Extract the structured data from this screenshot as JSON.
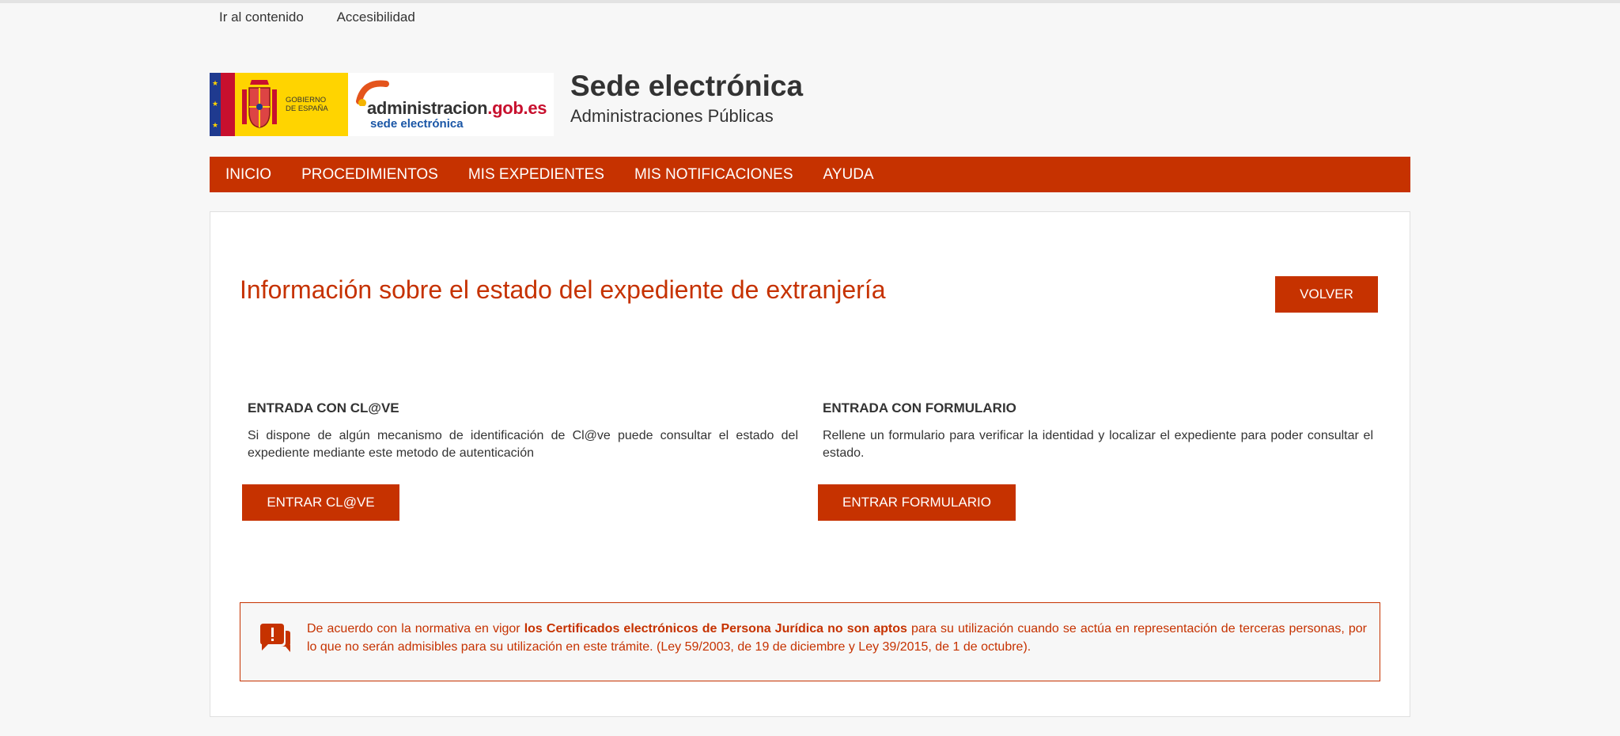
{
  "skip_links": {
    "content": "Ir al contenido",
    "accessibility": "Accesibilidad"
  },
  "logos": {
    "gobierno_line1": "GOBIERNO",
    "gobierno_line2": "DE ESPAÑA",
    "admin_main": "administracion",
    "admin_domain": ".gob.es",
    "admin_sub": "sede electrónica"
  },
  "header": {
    "title": "Sede electrónica",
    "subtitle": "Administraciones Públicas"
  },
  "nav": {
    "items": [
      "INICIO",
      "PROCEDIMIENTOS",
      "MIS EXPEDIENTES",
      "MIS NOTIFICACIONES",
      "AYUDA"
    ]
  },
  "main": {
    "title": "Información sobre el estado del expediente de extranjería",
    "back_button": "VOLVER",
    "clave": {
      "heading": "ENTRADA CON CL@VE",
      "text": "Si dispone de algún mecanismo de identificación de Cl@ve puede consultar el estado del expediente mediante este metodo de autenticación",
      "button": "ENTRAR CL@VE"
    },
    "form": {
      "heading": "ENTRADA CON FORMULARIO",
      "text": "Rellene un formulario para verificar la identidad y localizar el expediente para poder consultar el estado.",
      "button": "ENTRAR FORMULARIO"
    },
    "notice": {
      "pre": "De acuerdo con la normativa en vigor ",
      "bold": "los Certificados electrónicos de Persona Jurídica no son aptos",
      "post": " para su utilización cuando se actúa en representación de terceras personas, por lo que no serán admisibles para su utilización en este trámite. (Ley 59/2003, de 19 de diciembre y Ley 39/2015, de 1 de octubre)."
    }
  },
  "colors": {
    "accent": "#c63200",
    "background": "#f7f7f7"
  }
}
